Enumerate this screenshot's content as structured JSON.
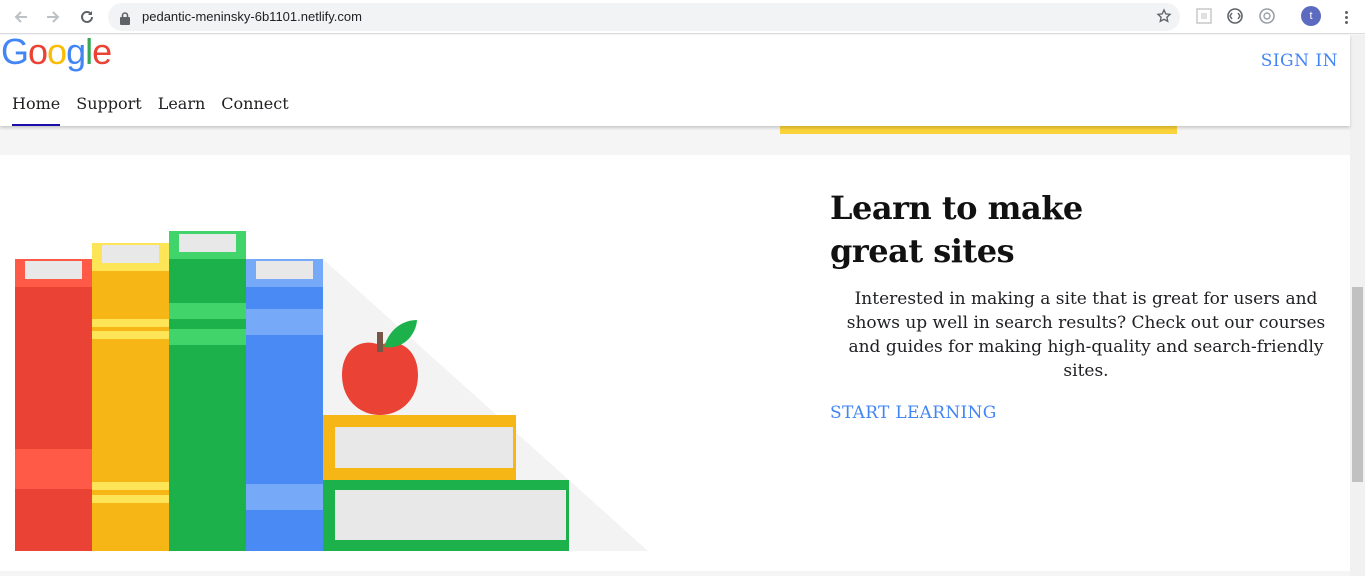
{
  "browser": {
    "url": "pedantic-meninsky-6b1101.netlify.com",
    "avatar_letter": "t",
    "icons": [
      "back-arrow-icon",
      "forward-arrow-icon",
      "reload-icon",
      "lock-icon",
      "star-icon",
      "extension-icon",
      "kebab-menu-icon"
    ]
  },
  "header": {
    "logo_letters": [
      {
        "char": "G",
        "color": "#4285f4"
      },
      {
        "char": "o",
        "color": "#ea4335"
      },
      {
        "char": "o",
        "color": "#fbbc05"
      },
      {
        "char": "g",
        "color": "#4285f4"
      },
      {
        "char": "l",
        "color": "#34a853"
      },
      {
        "char": "e",
        "color": "#ea4335"
      }
    ],
    "sign_in": "SIGN IN",
    "nav": [
      {
        "label": "Home",
        "active": true
      },
      {
        "label": "Support",
        "active": false
      },
      {
        "label": "Learn",
        "active": false
      },
      {
        "label": "Connect",
        "active": false
      }
    ]
  },
  "hero": {
    "title": "Learn to make great sites",
    "body": "Interested in making a site that is great for users and shows up well in search results? Check out our courses and guides for making high-quality and search-friendly sites.",
    "cta": "START LEARNING"
  },
  "colors": {
    "link_blue": "#4285f4",
    "red": "#ea4335",
    "yellow": "#fbbc05",
    "green": "#1db14b",
    "blue": "#4a8af4"
  }
}
